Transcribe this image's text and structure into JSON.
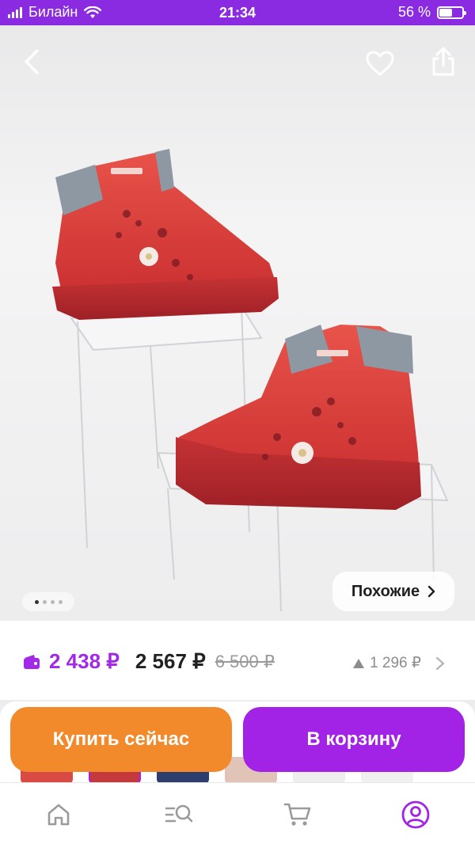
{
  "status_bar": {
    "carrier": "Билайн",
    "time": "21:34",
    "battery_percent": "56 %",
    "battery_level": 0.56
  },
  "top_actions": {
    "back_icon": "chevron-left-icon",
    "favorite_icon": "heart-icon",
    "share_icon": "share-icon"
  },
  "gallery": {
    "image_subject": "red leather kids boots on acrylic stand",
    "page_count": 4,
    "active_index": 0,
    "similar_label": "Похожие",
    "similar_chevron": "›"
  },
  "price": {
    "wallet_price": "2 438 ₽",
    "card_price": "2 567 ₽",
    "old_price": "6 500 ₽",
    "delta_value": "1 296 ₽",
    "delta_icon": "triangle-up-icon",
    "accent_color": "#a329e8"
  },
  "actions": {
    "buy_now_label": "Купить сейчас",
    "add_to_cart_label": "В корзину",
    "buy_color": "#f28a2b",
    "cart_color": "#a223e6"
  },
  "tabbar": {
    "items": [
      {
        "icon": "home-icon",
        "active": false
      },
      {
        "icon": "catalog-search-icon",
        "active": false
      },
      {
        "icon": "cart-icon",
        "active": false
      },
      {
        "icon": "profile-icon",
        "active": true
      }
    ],
    "active_color": "#a223e6",
    "inactive_color": "#9b9b9b"
  }
}
